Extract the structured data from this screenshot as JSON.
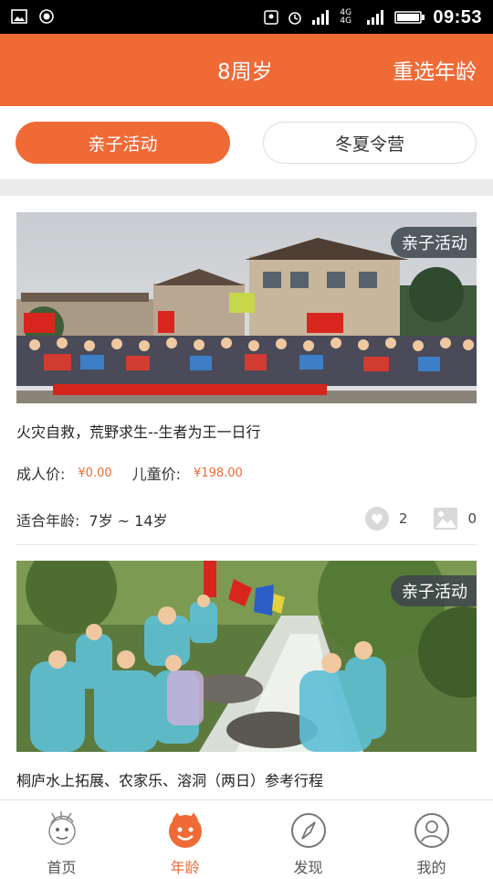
{
  "status_bar": {
    "time": "09:53",
    "network": "4G 4G"
  },
  "header": {
    "title": "8周岁",
    "action": "重选年龄"
  },
  "tabs": [
    {
      "label": "亲子活动",
      "active": true
    },
    {
      "label": "冬夏令营",
      "active": false
    }
  ],
  "cards": [
    {
      "badge": "亲子活动",
      "title": "火灾自救，荒野求生--生者为王一日行",
      "adult_label": "成人价:",
      "adult_price": "¥0.00",
      "child_label": "儿童价:",
      "child_price": "¥198.00",
      "age_label": "适合年龄:",
      "age_range": "7岁 ~ 14岁",
      "likes": "2",
      "photos": "0"
    },
    {
      "badge": "亲子活动",
      "title": "桐庐水上拓展、农家乐、溶洞（两日）参考行程"
    }
  ],
  "tabbar": [
    {
      "label": "首页",
      "icon": "mascot-icon",
      "active": false
    },
    {
      "label": "年龄",
      "icon": "smiley-icon",
      "active": true
    },
    {
      "label": "发现",
      "icon": "compass-icon",
      "active": false
    },
    {
      "label": "我的",
      "icon": "user-icon",
      "active": false
    }
  ],
  "colors": {
    "accent": "#f06a36",
    "badge_bg": "#3c444c"
  }
}
